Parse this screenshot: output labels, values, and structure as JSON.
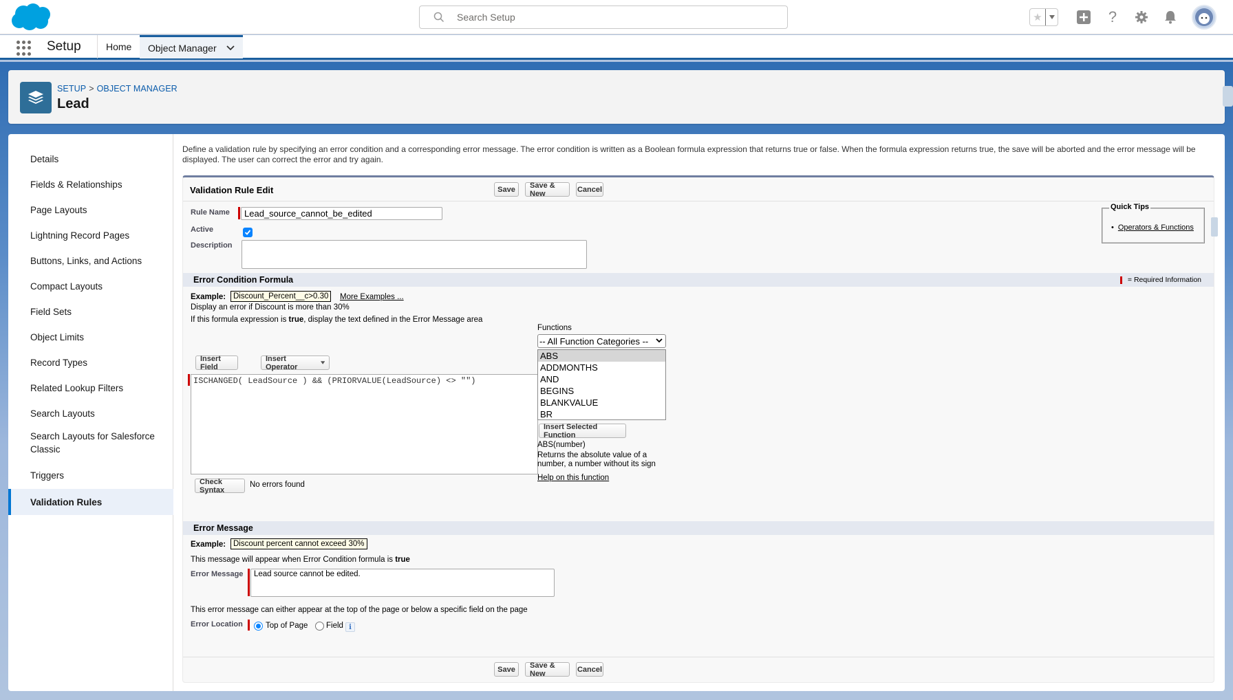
{
  "header": {
    "search_placeholder": "Search Setup",
    "icons": [
      "favorite-star-icon",
      "favorites-dropdown-icon",
      "global-add-icon",
      "help-icon",
      "setup-gear-icon",
      "notifications-bell-icon",
      "user-avatar"
    ]
  },
  "nav": {
    "app_name": "Setup",
    "tabs": [
      {
        "label": "Home",
        "active": false
      },
      {
        "label": "Object Manager",
        "active": true
      }
    ]
  },
  "page_header": {
    "breadcrumb": [
      "SETUP",
      "OBJECT MANAGER"
    ],
    "breadcrumb_sep": ">",
    "title": "Lead"
  },
  "sidebar": {
    "items": [
      {
        "label": "Details"
      },
      {
        "label": "Fields & Relationships"
      },
      {
        "label": "Page Layouts"
      },
      {
        "label": "Lightning Record Pages"
      },
      {
        "label": "Buttons, Links, and Actions"
      },
      {
        "label": "Compact Layouts"
      },
      {
        "label": "Field Sets"
      },
      {
        "label": "Object Limits"
      },
      {
        "label": "Record Types"
      },
      {
        "label": "Related Lookup Filters"
      },
      {
        "label": "Search Layouts"
      },
      {
        "label": "Search Layouts for Salesforce Classic"
      },
      {
        "label": "Triggers"
      },
      {
        "label": "Validation Rules",
        "active": true
      }
    ]
  },
  "intro_text": "Define a validation rule by specifying an error condition and a corresponding error message. The error condition is written as a Boolean formula expression that returns true or false. When the formula expression returns true, the save will be aborted and the error message will be displayed. The user can correct the error and try again.",
  "edit": {
    "title": "Validation Rule Edit",
    "buttons": {
      "save": "Save",
      "save_new": "Save & New",
      "cancel": "Cancel"
    },
    "rule_name_label": "Rule Name",
    "rule_name_value": "Lead_source_cannot_be_edited",
    "active_label": "Active",
    "active_checked": true,
    "description_label": "Description",
    "description_value": "",
    "quick_tips": {
      "title": "Quick Tips",
      "items": [
        "Operators & Functions"
      ]
    }
  },
  "formula_section": {
    "title": "Error Condition Formula",
    "required_legend": "= Required Information",
    "example_label": "Example:",
    "example_value": "Discount_Percent__c>0.30",
    "more_examples": "More Examples ...",
    "example_desc": "Display an error if Discount is more than 30%",
    "hint_pre": "If this formula expression is ",
    "hint_bold": "true",
    "hint_post": ", display the text defined in the Error Message area",
    "insert_field": "Insert Field",
    "insert_operator": "Insert Operator",
    "formula": "ISCHANGED( LeadSource ) && (PRIORVALUE(LeadSource) <> \"\")",
    "check_syntax": "Check Syntax",
    "syntax_result": "No errors found",
    "functions_label": "Functions",
    "function_category": "-- All Function Categories --",
    "function_list": [
      "ABS",
      "ADDMONTHS",
      "AND",
      "BEGINS",
      "BLANKVALUE",
      "BR"
    ],
    "selected_function": "ABS",
    "insert_selected_function": "Insert Selected Function",
    "function_signature": "ABS(number)",
    "function_desc_line1": "Returns the absolute value of a",
    "function_desc_line2": "number, a number without its sign",
    "help_link": "Help on this function"
  },
  "message_section": {
    "title": "Error Message",
    "example_label": "Example:",
    "example_value": "Discount percent cannot exceed 30%",
    "hint_pre": "This message will appear when Error Condition formula is ",
    "hint_bold": "true",
    "error_message_label": "Error Message",
    "error_message_value": "Lead source cannot be edited.",
    "location_hint": "This error message can either appear at the top of the page or below a specific field on the page",
    "location_label": "Error Location",
    "location_options": [
      "Top of Page",
      "Field"
    ],
    "location_selected": "Top of Page"
  },
  "colors": {
    "brand_blue": "#1b5f9e",
    "required_red": "#cc0000",
    "active_nav": "#0176d3",
    "object_icon_bg": "#2e6e98"
  }
}
